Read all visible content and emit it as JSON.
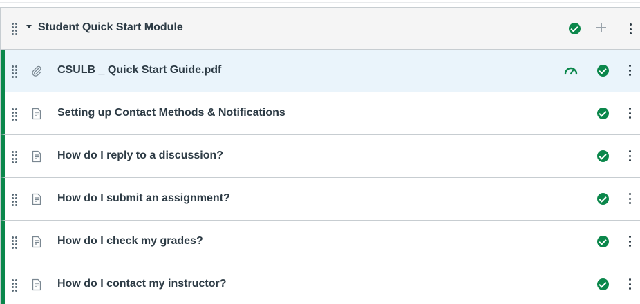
{
  "module": {
    "title": "Student Quick Start Module",
    "icons": {
      "drag": "drag-handle-icon",
      "collapse": "caret-down-icon",
      "published": "published-check-icon",
      "add": "plus-icon",
      "menu": "kebab-menu-icon"
    },
    "items": [
      {
        "title": "CSULB _ Quick Start Guide.pdf",
        "type_icon": "attachment-icon",
        "selected": true,
        "has_mastery_paths": true
      },
      {
        "title": "Setting up Contact Methods & Notifications",
        "type_icon": "page-icon",
        "selected": false
      },
      {
        "title": "How do I reply to a discussion?",
        "type_icon": "page-icon",
        "selected": false
      },
      {
        "title": "How do I submit an assignment?",
        "type_icon": "page-icon",
        "selected": false
      },
      {
        "title": "How do I check my grades?",
        "type_icon": "page-icon",
        "selected": false
      },
      {
        "title": "How do I contact my instructor?",
        "type_icon": "page-icon",
        "selected": false
      }
    ]
  },
  "colors": {
    "accent_green": "#0b874b",
    "header_bg": "#f5f5f5",
    "selected_bg": "#eaf4fb",
    "text": "#2d3b45",
    "border": "#c7cdd1"
  }
}
